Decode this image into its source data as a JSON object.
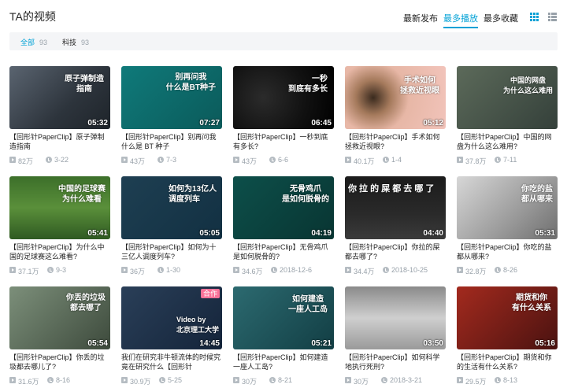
{
  "header": {
    "title": "TA的视频",
    "sort_options": [
      "最新发布",
      "最多播放",
      "最多收藏"
    ]
  },
  "filter": {
    "tags": [
      {
        "label": "全部",
        "count": "93"
      },
      {
        "label": "科技",
        "count": "93"
      }
    ]
  },
  "colors": {
    "accent": "#00a1d6",
    "muted": "#99a2aa",
    "badge": "#fb7299"
  },
  "videos": [
    {
      "title": "【回形针PaperClip】原子弹制造指南",
      "views": "82万",
      "date": "3-22",
      "duration": "05:32",
      "thumb_text": "原子弹制造\n指南"
    },
    {
      "title": "【回形针PaperClip】别再问我什么是 BT 种子",
      "views": "43万",
      "date": "7-3",
      "duration": "07:27",
      "thumb_text": "别再问我\n什么是BT种子"
    },
    {
      "title": "【回形针PaperClip】一秒到底有多长?",
      "views": "43万",
      "date": "6-6",
      "duration": "06:45",
      "thumb_text": "一秒\n到底有多长"
    },
    {
      "title": "【回形针PaperClip】手术如何拯救近视眼?",
      "views": "40.1万",
      "date": "1-4",
      "duration": "05:12",
      "thumb_text": "手术如何\n拯救近视眼"
    },
    {
      "title": "【回形针PaperClip】中国的网盘为什么这么难用?",
      "views": "37.8万",
      "date": "7-11",
      "duration": "",
      "thumb_text": "中国的网盘\n为什么这么难用"
    },
    {
      "title": "【回形针PaperClip】为什么中国的足球赛这么难看?",
      "views": "37.1万",
      "date": "9-3",
      "duration": "05:41",
      "thumb_text": "中国的足球赛\n为什么难看"
    },
    {
      "title": "【回形针PaperClip】如何为十三亿人调度列车?",
      "views": "36万",
      "date": "1-30",
      "duration": "05:05",
      "thumb_text": "如何为13亿人\n调度列车"
    },
    {
      "title": "【回形针PaperClip】无骨鸡爪是如何脱骨的?",
      "views": "34.6万",
      "date": "2018-12-6",
      "duration": "04:19",
      "thumb_text": "无骨鸡爪\n是如何脱骨的"
    },
    {
      "title": "【回形针PaperClip】你拉的屎都去哪了?",
      "views": "34.4万",
      "date": "2018-10-25",
      "duration": "04:40",
      "thumb_text": "你 拉 的 屎 都 去 哪 了"
    },
    {
      "title": "【回形针PaperClip】你吃的盐都从哪来?",
      "views": "32.8万",
      "date": "8-26",
      "duration": "05:31",
      "thumb_text": "你吃的盐\n都从哪来"
    },
    {
      "title": "【回形针PaperClip】你丢的垃圾都去哪儿了?",
      "views": "31.6万",
      "date": "8-16",
      "duration": "05:54",
      "thumb_text": "你丢的垃圾\n都去哪了"
    },
    {
      "title": "我们在研究非牛顿流体的时候究竟在研究什么【回形针PaperClip】",
      "views": "30.9万",
      "date": "5-25",
      "duration": "14:45",
      "thumb_text": "Video by\n北京理工大学",
      "badge": "合作"
    },
    {
      "title": "【回形针PaperClip】如何建造一座人工岛?",
      "views": "30万",
      "date": "8-21",
      "duration": "05:21",
      "thumb_text": "如何建造\n一座人工岛"
    },
    {
      "title": "【回形针PaperClip】如何科学地执行死刑?",
      "views": "30万",
      "date": "2018-3-21",
      "duration": "03:50",
      "thumb_text": ""
    },
    {
      "title": "【回形针PaperClip】期货和你的生活有什么关系?",
      "views": "29.5万",
      "date": "8-13",
      "duration": "05:16",
      "thumb_text": "期货和你\n有什么关系"
    }
  ]
}
